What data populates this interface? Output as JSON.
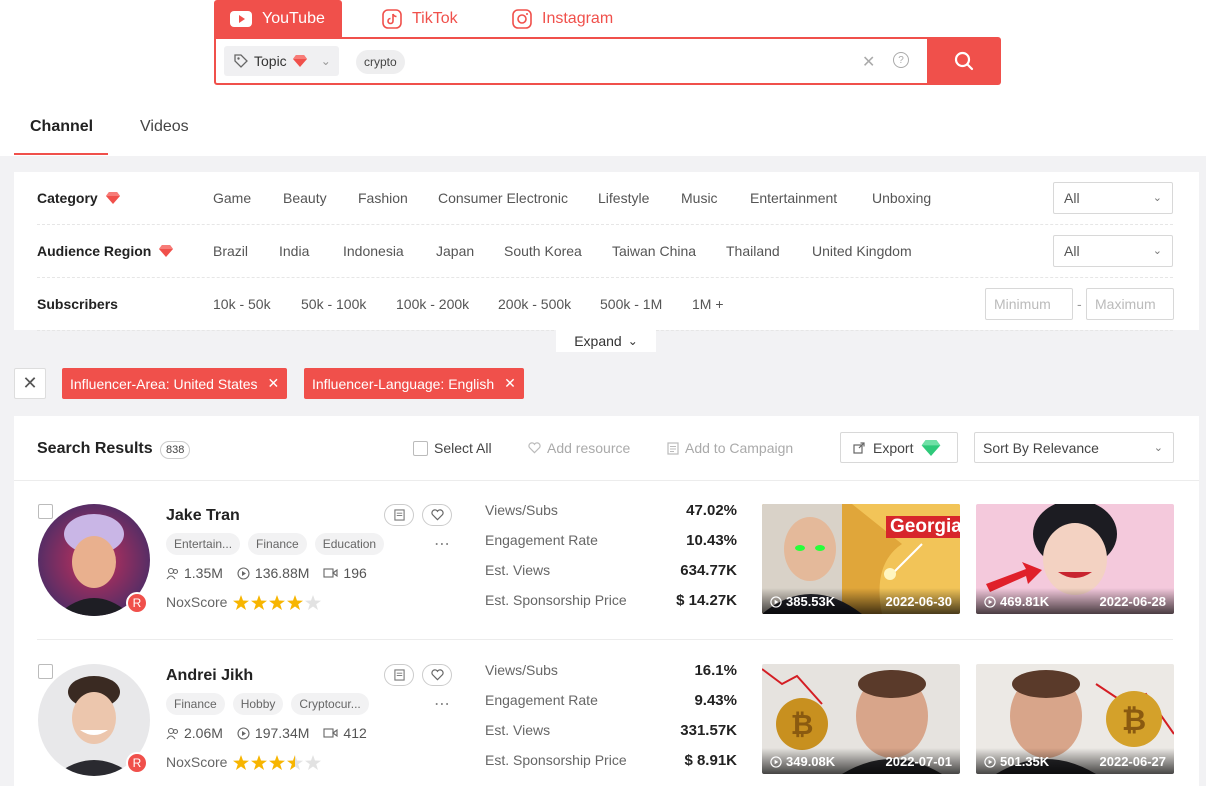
{
  "platform_tabs": [
    {
      "label": "YouTube",
      "active": true
    },
    {
      "label": "TikTok",
      "active": false
    },
    {
      "label": "Instagram",
      "active": false
    }
  ],
  "search": {
    "scope_label": "Topic",
    "keyword_chip": "crypto"
  },
  "sub_tabs": [
    "Channel",
    "Videos"
  ],
  "filters": {
    "category": {
      "label": "Category",
      "options": [
        "Game",
        "Beauty",
        "Fashion",
        "Consumer Electronic",
        "Lifestyle",
        "Music",
        "Entertainment",
        "Unboxing"
      ],
      "select_value": "All"
    },
    "audience_region": {
      "label": "Audience Region",
      "options": [
        "Brazil",
        "India",
        "Indonesia",
        "Japan",
        "South Korea",
        "Taiwan China",
        "Thailand",
        "United Kingdom"
      ],
      "select_value": "All"
    },
    "subscribers": {
      "label": "Subscribers",
      "options": [
        "10k - 50k",
        "50k - 100k",
        "100k - 200k",
        "200k - 500k",
        "500k - 1M",
        "1M +"
      ],
      "min_placeholder": "Minimum",
      "max_placeholder": "Maximum",
      "separator": "-"
    },
    "expand_label": "Expand"
  },
  "active_filters": [
    "Influencer-Area: United States",
    "Influencer-Language: English"
  ],
  "results": {
    "title": "Search Results",
    "count": "838",
    "select_all": "Select All",
    "add_resource": "Add resource",
    "add_campaign": "Add to Campaign",
    "export": "Export",
    "sort": "Sort By Relevance",
    "metric_labels": [
      "Views/Subs",
      "Engagement Rate",
      "Est. Views",
      "Est. Sponsorship Price"
    ],
    "nox_label": "NoxScore",
    "badge": "R",
    "channels": [
      {
        "name": "Jake Tran",
        "tags": [
          "Entertain...",
          "Finance",
          "Education"
        ],
        "subscribers": "1.35M",
        "views": "136.88M",
        "videos": "196",
        "nox_stars": 4,
        "metrics": [
          "47.02%",
          "10.43%",
          "634.77K",
          "$ 14.27K"
        ],
        "thumbs": [
          {
            "views": "385.53K",
            "date": "2022-06-30",
            "overlay": "Georgia"
          },
          {
            "views": "469.81K",
            "date": "2022-06-28",
            "overlay": ""
          }
        ]
      },
      {
        "name": "Andrei Jikh",
        "tags": [
          "Finance",
          "Hobby",
          "Cryptocur..."
        ],
        "subscribers": "2.06M",
        "views": "197.34M",
        "videos": "412",
        "nox_stars": 3.5,
        "metrics": [
          "16.1%",
          "9.43%",
          "331.57K",
          "$ 8.91K"
        ],
        "thumbs": [
          {
            "views": "349.08K",
            "date": "2022-07-01",
            "overlay": ""
          },
          {
            "views": "501.35K",
            "date": "2022-06-27",
            "overlay": ""
          }
        ]
      }
    ]
  },
  "colors": {
    "accent": "#f0504b",
    "star": "#f7b500",
    "gem": "#f0504b",
    "export_gem": "#2ec97a"
  }
}
